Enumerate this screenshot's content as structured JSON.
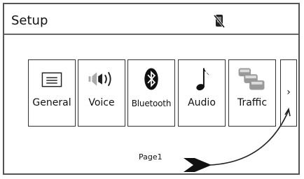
{
  "header": {
    "title": "Setup",
    "status_icon": "phone-muted-icon"
  },
  "menu": {
    "items": [
      {
        "label": "General",
        "icon": "general-settings-icon"
      },
      {
        "label": "Voice",
        "icon": "speaker-volume-icon"
      },
      {
        "label": "Bluetooth",
        "icon": "bluetooth-icon"
      },
      {
        "label": "Audio",
        "icon": "music-note-icon"
      },
      {
        "label": "Traffic",
        "icon": "traffic-cars-icon"
      }
    ],
    "next_glyph": "›"
  },
  "pager": {
    "label": "Page1"
  },
  "annotation": {
    "gesture": "swipe-arrow"
  },
  "colors": {
    "border": "#333333",
    "background": "#ffffff",
    "text": "#111111"
  }
}
